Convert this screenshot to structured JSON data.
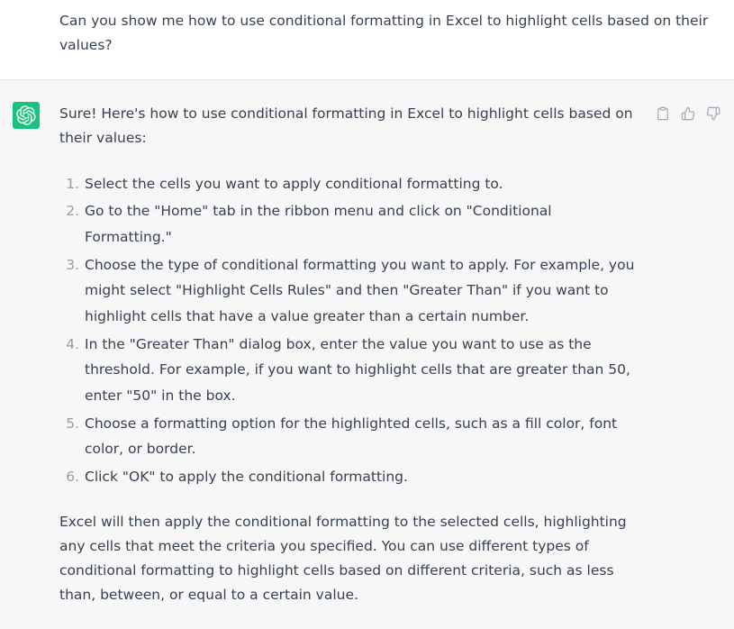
{
  "user": {
    "text": "Can you show me how to use conditional formatting in Excel to highlight cells based on their values?"
  },
  "assistant": {
    "intro": "Sure! Here's how to use conditional formatting in Excel to highlight cells based on their values:",
    "steps": [
      "Select the cells you want to apply conditional formatting to.",
      "Go to the \"Home\" tab in the ribbon menu and click on \"Conditional Formatting.\"",
      "Choose the type of conditional formatting you want to apply. For example, you might select \"Highlight Cells Rules\" and then \"Greater Than\" if you want to highlight cells that have a value greater than a certain number.",
      "In the \"Greater Than\" dialog box, enter the value you want to use as the threshold. For example, if you want to highlight cells that are greater than 50, enter \"50\" in the box.",
      "Choose a formatting option for the highlighted cells, such as a fill color, font color, or border.",
      "Click \"OK\" to apply the conditional formatting."
    ],
    "outro": "Excel will then apply the conditional formatting to the selected cells, highlighting any cells that meet the criteria you specified. You can use different types of conditional formatting to highlight cells based on different criteria, such as less than, between, or equal to a certain value."
  }
}
